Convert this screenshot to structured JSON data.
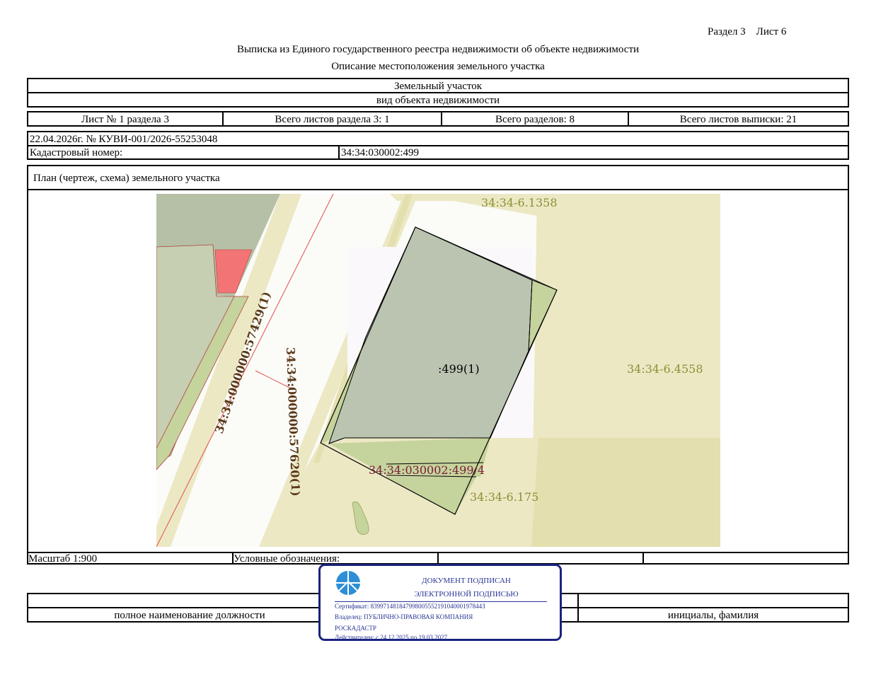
{
  "header": {
    "section_sheet": "Раздел 3    Лист 6",
    "title": "Выписка из Единого государственного реестра недвижимости об объекте недвижимости",
    "subtitle": "Описание местоположения земельного участка"
  },
  "object": {
    "type_value": "Земельный участок",
    "type_caption": "вид объекта недвижимости"
  },
  "sheets": {
    "sheet_of_section": "Лист № 1 раздела 3",
    "total_section_sheets": "Всего листов раздела 3: 1",
    "total_sections": "Всего разделов: 8",
    "total_extract_sheets": "Всего листов выписки: 21"
  },
  "doc": {
    "date_number": "22.04.2026г. № КУВИ-001/2026-55253048",
    "cadastral_label": "Кадастровый номер:",
    "cadastral_value": "34:34:030002:499"
  },
  "plan": {
    "heading": "План (чертеж, схема) земельного участка",
    "labels": {
      "zone_top": "34:34-6.1358",
      "zone_right": "34:34-6.4558",
      "zone_bottom": "34:34-6.175",
      "parcel": ":499(1)",
      "subparcel": "34:34:030002:499/4",
      "road1": "34:34:000000:57429(1)",
      "road2": "34:34:000000:57620(1)"
    }
  },
  "footer": {
    "scale": "Масштаб 1:900",
    "legend": "Условные обозначения:",
    "position_caption": "полное наименование должности",
    "signature_caption": "инициалы, фамилия"
  },
  "stamp": {
    "line1": "ДОКУМЕНТ ПОДПИСАН",
    "line2": "ЭЛЕКТРОННОЙ ПОДПИСЬЮ",
    "certificate": "Сертификат: 83997148184799800555219104000197844З",
    "owner": "Владелец: ПУБЛИЧНО-ПРАВОВАЯ КОМПАНИЯ",
    "owner2": "РОСКАДАСТР",
    "valid": "Действителен: с 24.12.2025 по 19.03.2027"
  },
  "colors": {
    "zone_fill": "#ece8c4",
    "zone_dark": "#e4dfae",
    "parcel_fill": "#bac4b0",
    "green_fill": "#c5d39c",
    "red_fill": "#f27474",
    "stamp_blue": "#1a237e",
    "label_olive": "#8b9035",
    "label_maroon": "#7b1c3a"
  }
}
